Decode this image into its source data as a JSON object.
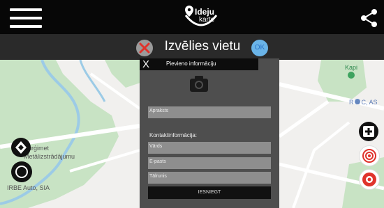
{
  "header": {
    "logo_line1": "Ideju",
    "logo_line2": "karte"
  },
  "titlebar": {
    "title": "Izvēlies vietu",
    "ok_label": "OK"
  },
  "map": {
    "labels": [
      {
        "id": "kapi",
        "text": "Kapi"
      },
      {
        "id": "rcas",
        "text": "R & C, AS"
      },
      {
        "id": "burgimet",
        "text": "Burģimet"
      },
      {
        "id": "metalla",
        "text": "Metālizstrādājumu"
      },
      {
        "id": "irbe",
        "text": "IRBE Auto, SIA"
      }
    ]
  },
  "modal": {
    "close": "X",
    "title": "Pievieno informāciju",
    "description_placeholder": "Apraksts",
    "contact_heading": "Kontaktinformācija:",
    "name_placeholder": "Vārds",
    "email_placeholder": "E-pasts",
    "phone_placeholder": "Tālrunis",
    "submit_label": "IESNIEGT"
  },
  "colors": {
    "topbar": "#070707",
    "titlebar": "#2a2a2a",
    "modal": "#4e4e4e",
    "field": "#8e8e8e",
    "park": "#c8e3c4",
    "river": "#9ccbe6",
    "accent_red": "#e0332c"
  }
}
